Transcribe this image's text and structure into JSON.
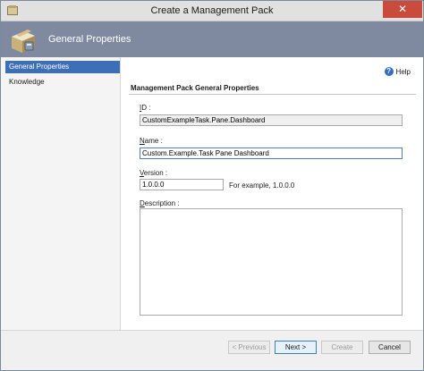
{
  "window": {
    "title": "Create a Management Pack",
    "close_glyph": "✕"
  },
  "banner": {
    "title": "General Properties",
    "icon": "management-pack-icon"
  },
  "nav": {
    "items": [
      {
        "label": "General Properties",
        "selected": true
      },
      {
        "label": "Knowledge",
        "selected": false
      }
    ]
  },
  "help": {
    "label": "Help",
    "icon_glyph": "?"
  },
  "form": {
    "section_title": "Management Pack General Properties",
    "id": {
      "label_accel": "I",
      "label_rest": "D :",
      "value": "CustomExampleTask.Pane.Dashboard"
    },
    "name": {
      "label_accel": "N",
      "label_rest": "ame :",
      "value": "Custom.Example.Task Pane Dashboard"
    },
    "version": {
      "label_accel": "V",
      "label_rest": "ersion :",
      "value": "1.0.0.0",
      "example": "For example, 1.0.0.0"
    },
    "description": {
      "label_accel": "D",
      "label_rest": "escription :",
      "value": ""
    }
  },
  "footer": {
    "previous_label": "< Previous",
    "next_label": "Next >",
    "create_label": "Create",
    "cancel_label": "Cancel"
  },
  "colors": {
    "banner": "#7f8aa1",
    "nav_selected": "#3d6fb6",
    "close_button": "#c84b3c"
  }
}
